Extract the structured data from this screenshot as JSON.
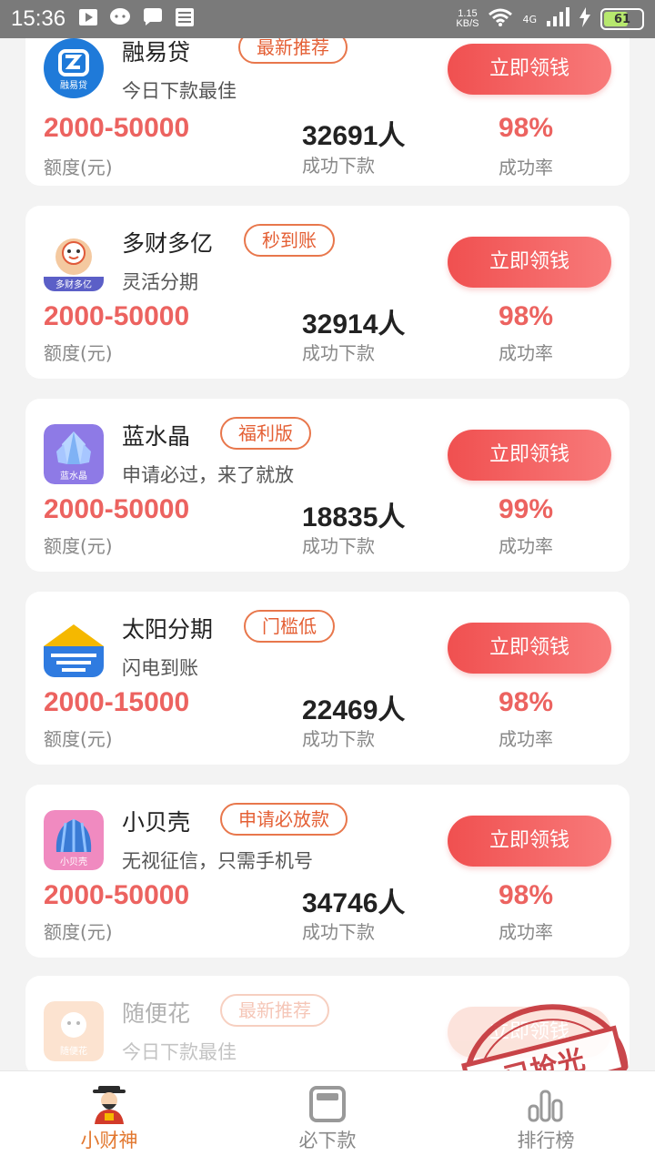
{
  "status_bar": {
    "time": "15:36",
    "net_speed_value": "1.15",
    "net_speed_unit": "KB/S",
    "network": "4G",
    "battery": "61",
    "icons": [
      "play-icon",
      "chat-icon",
      "message-icon",
      "news-icon",
      "wifi-icon",
      "signal-icon",
      "charging-icon"
    ]
  },
  "labels": {
    "amount_label": "额度(元)",
    "count_label": "成功下款",
    "rate_label": "成功率",
    "cta": "立即领钱"
  },
  "loans": [
    {
      "name": "融易贷",
      "tag": "最新推荐",
      "desc": "今日下款最佳",
      "amount": "2000-50000",
      "count": "32691人",
      "rate": "98%",
      "logo_text": "融易贷"
    },
    {
      "name": "多财多亿",
      "tag": "秒到账",
      "desc": "灵活分期",
      "amount": "2000-50000",
      "count": "32914人",
      "rate": "98%",
      "logo_text": "多财多亿"
    },
    {
      "name": "蓝水晶",
      "tag": "福利版",
      "desc": "申请必过，来了就放",
      "amount": "2000-50000",
      "count": "18835人",
      "rate": "99%",
      "logo_text": "蓝水晶"
    },
    {
      "name": "太阳分期",
      "tag": "门槛低",
      "desc": "闪电到账",
      "amount": "2000-15000",
      "count": "22469人",
      "rate": "98%",
      "logo_text": ""
    },
    {
      "name": "小贝壳",
      "tag": "申请必放款",
      "desc": "无视征信，只需手机号",
      "amount": "2000-50000",
      "count": "34746人",
      "rate": "98%",
      "logo_text": "小贝壳"
    },
    {
      "name": "随便花",
      "tag": "最新推荐",
      "desc": "今日下款最佳",
      "amount": "",
      "count": "",
      "rate": "",
      "logo_text": "随便花",
      "sold_out": true,
      "stamp_text": "已抢光"
    }
  ],
  "bottom_nav": [
    {
      "label": "小财神",
      "icon": "fortune-god-icon",
      "active": true
    },
    {
      "label": "必下款",
      "icon": "wallet-icon",
      "active": false
    },
    {
      "label": "排行榜",
      "icon": "bar-chart-icon",
      "active": false
    }
  ],
  "colors": {
    "accent_red": "#ec6360",
    "tag_orange": "#e45f34",
    "nav_active": "#e2772e"
  }
}
